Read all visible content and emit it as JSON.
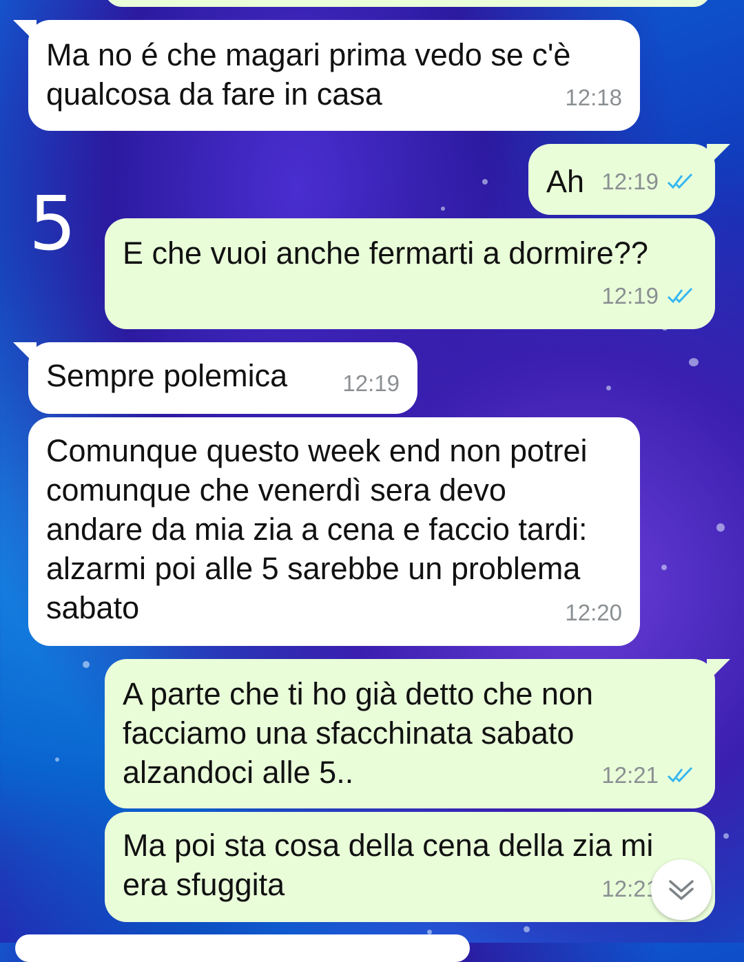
{
  "overlay": {
    "number_label": "5"
  },
  "messages": [
    {
      "side": "in",
      "text": "Ma no é che magari prima vedo se c'è\nqualcosa da fare in casa",
      "time": "12:18"
    },
    {
      "side": "out",
      "text": "Ah",
      "time": "12:19",
      "status": "read"
    },
    {
      "side": "out",
      "text": "E che vuoi anche fermarti a dormire??",
      "time": "12:19",
      "status": "read"
    },
    {
      "side": "in",
      "text": "Sempre polemica",
      "time": "12:19"
    },
    {
      "side": "in",
      "text": "Comunque questo week end non potrei\ncomunque che venerdì sera devo\nandare da mia zia a cena e faccio tardi:\nalzarmi poi alle 5 sarebbe un problema\nsabato",
      "time": "12:20"
    },
    {
      "side": "out",
      "text": "A parte che ti ho già detto che non\nfacciamo una sfacchinata sabato\nalzandoci alle 5..",
      "time": "12:21",
      "status": "read"
    },
    {
      "side": "out",
      "text": "Ma poi sta cosa della cena della zia mi\nera sfuggita",
      "time": "12:21",
      "status": "read"
    }
  ],
  "colors": {
    "incoming_bubble": "#ffffff",
    "outgoing_bubble": "#e9fdd9",
    "read_tick": "#34b7f1",
    "timestamp": "#8a8f92"
  },
  "icons": {
    "read_status": "double-check-icon",
    "scroll_down": "chevron-down-double-icon"
  }
}
